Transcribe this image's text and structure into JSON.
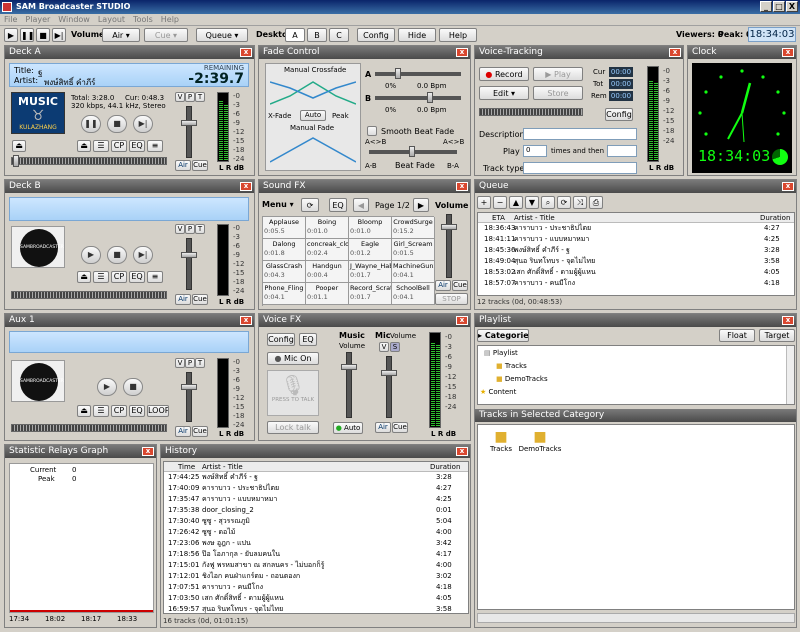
{
  "app": {
    "title": "SAM Broadcaster STUDIO",
    "min": "_",
    "max": "□",
    "close": "X"
  },
  "menu": [
    "File",
    "Player",
    "Window",
    "Layout",
    "Tools",
    "Help"
  ],
  "toolbar": {
    "volume_label": "Volume",
    "air": "Air",
    "cue": "Cue",
    "queue": "Queue",
    "desktop_label": "Desktop",
    "desktops": [
      "A",
      "B",
      "C"
    ],
    "config": "Config",
    "hide": "Hide",
    "help": "Help",
    "viewers": "Viewers: 0",
    "peak": "Peak: 0",
    "time": "18:34:03"
  },
  "deckA": {
    "header": "Deck A",
    "title_label": "Title:",
    "title": "ฐ",
    "artist_label": "Artist:",
    "artist": "พงษ์สิทธิ์ คำภีร์",
    "remaining_label": "REMAINING",
    "remaining": "-2:39.7",
    "art_line1": "MUSIC",
    "art_line2": "KULAZHANG",
    "total": "Total: 3:28.0",
    "cur": "Cur: 0:48.3",
    "bitrate": "320 kbps, 44.1 kHz, Stereo",
    "cp": "CP",
    "eq": "EQ",
    "air": "Air",
    "cue": "Cue",
    "vpt": [
      "V",
      "P",
      "T"
    ],
    "lr": "L R dB"
  },
  "fade": {
    "header": "Fade Control",
    "manual_crossfade": "Manual Crossfade",
    "xfade": "X-Fade",
    "auto": "Auto",
    "peak": "Peak",
    "manual_fade": "Manual Fade",
    "a": "A",
    "b": "B",
    "bpm": "0.0 Bpm",
    "pct": "0%",
    "smooth": "Smooth Beat Fade",
    "ab": "A<>B",
    "ba": "A<>B",
    "a_b": "A-B",
    "beatfade": "Beat Fade",
    "b_a": "B-A"
  },
  "voice": {
    "header": "Voice-Tracking",
    "record": "Record",
    "play": "Play",
    "edit": "Edit",
    "store": "Store",
    "cur_label": "Cur",
    "tot_label": "Tot",
    "rem_label": "Rem",
    "counter": "00:00",
    "config": "Config",
    "description": "Description",
    "play_label": "Play",
    "times": "times and then",
    "count": "0",
    "track_type": "Track type",
    "lr": "L R dB"
  },
  "clock": {
    "header": "Clock",
    "digital": "18:34:03"
  },
  "deckB": {
    "header": "Deck B",
    "brand": "SAMBROADCASTER",
    "cp": "CP",
    "eq": "EQ",
    "air": "Air",
    "cue": "Cue",
    "vpt": [
      "V",
      "P",
      "T"
    ],
    "lr": "L R dB"
  },
  "soundfx": {
    "header": "Sound FX",
    "menu": "Menu",
    "eq": "EQ",
    "page": "Page 1/2",
    "volume": "Volume",
    "air": "Air",
    "cue": "Cue",
    "stop": "STOP",
    "cells": [
      {
        "n": "Applause",
        "t": "0:05.5"
      },
      {
        "n": "Boing",
        "t": "0:01.0"
      },
      {
        "n": "Bloomp",
        "t": "0:01.0"
      },
      {
        "n": "CrowdSurge",
        "t": "0:15.2"
      },
      {
        "n": "Dalong",
        "t": "0:01.8"
      },
      {
        "n": "concreak_closi",
        "t": "0:02.4"
      },
      {
        "n": "Eagle",
        "t": "0:01.2"
      },
      {
        "n": "Girl_Scream",
        "t": "0:01.5"
      },
      {
        "n": "GlassCrash",
        "t": "0:04.3"
      },
      {
        "n": "Handgun",
        "t": "0:00.4"
      },
      {
        "n": "J_Wayne_Habit",
        "t": "0:01.7"
      },
      {
        "n": "MachineGunShe",
        "t": "0:04.1"
      },
      {
        "n": "Phone_Fling",
        "t": "0:04.1"
      },
      {
        "n": "Pooper",
        "t": "0:01.1"
      },
      {
        "n": "Record_Scratch",
        "t": "0:01.7"
      },
      {
        "n": "SchoolBell",
        "t": "0:04.1"
      }
    ]
  },
  "queue": {
    "header": "Queue",
    "cols": [
      "ETA",
      "Artist - Title",
      "Duration"
    ],
    "rows": [
      {
        "eta": "18:36:43",
        "title": "คาราบาว - ประชาธิปไตย",
        "dur": "4:27"
      },
      {
        "eta": "18:41:11",
        "title": "คาราบาว - แบบหมาหมา",
        "dur": "4:25"
      },
      {
        "eta": "18:45:36",
        "title": "พงษ์สิทธิ์ คำภีร์ - ฐ",
        "dur": "3:28"
      },
      {
        "eta": "18:49:04",
        "title": "สุนอ รินทโทบร - จุดไม่ไทย",
        "dur": "3:58"
      },
      {
        "eta": "18:53:02",
        "title": "เสก ศักดิ์สิทธิ์ - ดามผู้ผู้แหน",
        "dur": "4:05"
      },
      {
        "eta": "18:57:07",
        "title": "คาราบาว - คนมีโกง",
        "dur": "4:18"
      }
    ],
    "status": "12 tracks (0d, 00:48:53)"
  },
  "aux": {
    "header": "Aux 1",
    "brand": "SAMBROADCASTER",
    "cp": "CP",
    "eq": "EQ",
    "loop": "LOOP",
    "air": "Air",
    "cue": "Cue",
    "vpt": [
      "V",
      "P",
      "T"
    ],
    "lr": "L R dB"
  },
  "voicefx": {
    "header": "Voice FX",
    "config": "Config",
    "eq": "EQ",
    "music": "Music",
    "mic": "Mic",
    "volume": "Volume",
    "mic_on": "Mic On",
    "press": "PRESS TO TALK",
    "lock": "Lock talk",
    "auto": "Auto",
    "air": "Air",
    "cue": "Cue",
    "v": "V",
    "s": "S",
    "lr": "L R dB"
  },
  "playlist": {
    "header": "Playlist",
    "categories": "Categories",
    "float": "Float",
    "target": "Target",
    "tree": [
      "Playlist",
      "Tracks",
      "DemoTracks",
      "Content"
    ],
    "sel_header": "Tracks in Selected Category",
    "items": [
      "Tracks",
      "DemoTracks"
    ]
  },
  "stats": {
    "header": "Statistic Relays Graph",
    "current": "Current",
    "peak": "Peak",
    "current_val": "0",
    "peak_val": "0",
    "x": [
      "17:34",
      "18:02",
      "18:17",
      "18:33"
    ]
  },
  "history": {
    "header": "History",
    "cols": [
      "Time",
      "Artist - Title",
      "Duration"
    ],
    "rows": [
      {
        "t": "17:44:25",
        "title": "พงษ์สิทธิ์ คำภีร์ - ฐ",
        "dur": "3:28"
      },
      {
        "t": "17:40:09",
        "title": "คาราบาว - ประชาธิปไตย",
        "dur": "4:27"
      },
      {
        "t": "17:35:47",
        "title": "คาราบาว - แบบหมาหมา",
        "dur": "4:25"
      },
      {
        "t": "17:35:38",
        "title": "door_closing_2",
        "dur": "0:01"
      },
      {
        "t": "17:30:40",
        "title": "ซูซู - สุวรรณภูมิ",
        "dur": "5:04"
      },
      {
        "t": "17:26:42",
        "title": "ซูซู - ดอไม้",
        "dur": "4:00"
      },
      {
        "t": "17:23:06",
        "title": "พงษ อูฎก - แปน",
        "dur": "3:42"
      },
      {
        "t": "17:18:56",
        "title": "ป๊อ โอภากุล - ยับลมคนใน",
        "dur": "4:17"
      },
      {
        "t": "17:15:01",
        "title": "กังฟู พรหมสาขา ณ สกลนคร - ไม่บอกก็รู้",
        "dur": "4:00"
      },
      {
        "t": "17:12:01",
        "title": "ชิงไอก คนฝ่าแกร์ตม - ถอนตองก",
        "dur": "3:02"
      },
      {
        "t": "17:07:51",
        "title": "คาราบาว - คนมีโกง",
        "dur": "4:18"
      },
      {
        "t": "17:03:50",
        "title": "เสก ศักดิ์สิทธิ์ - ดามผู้ผู้แหน",
        "dur": "4:05"
      },
      {
        "t": "16:59:57",
        "title": "สุนอ รินทโทบร - จุดไม่ไทย",
        "dur": "3:58"
      }
    ],
    "status": "16 tracks (0d, 01:01:15)"
  }
}
